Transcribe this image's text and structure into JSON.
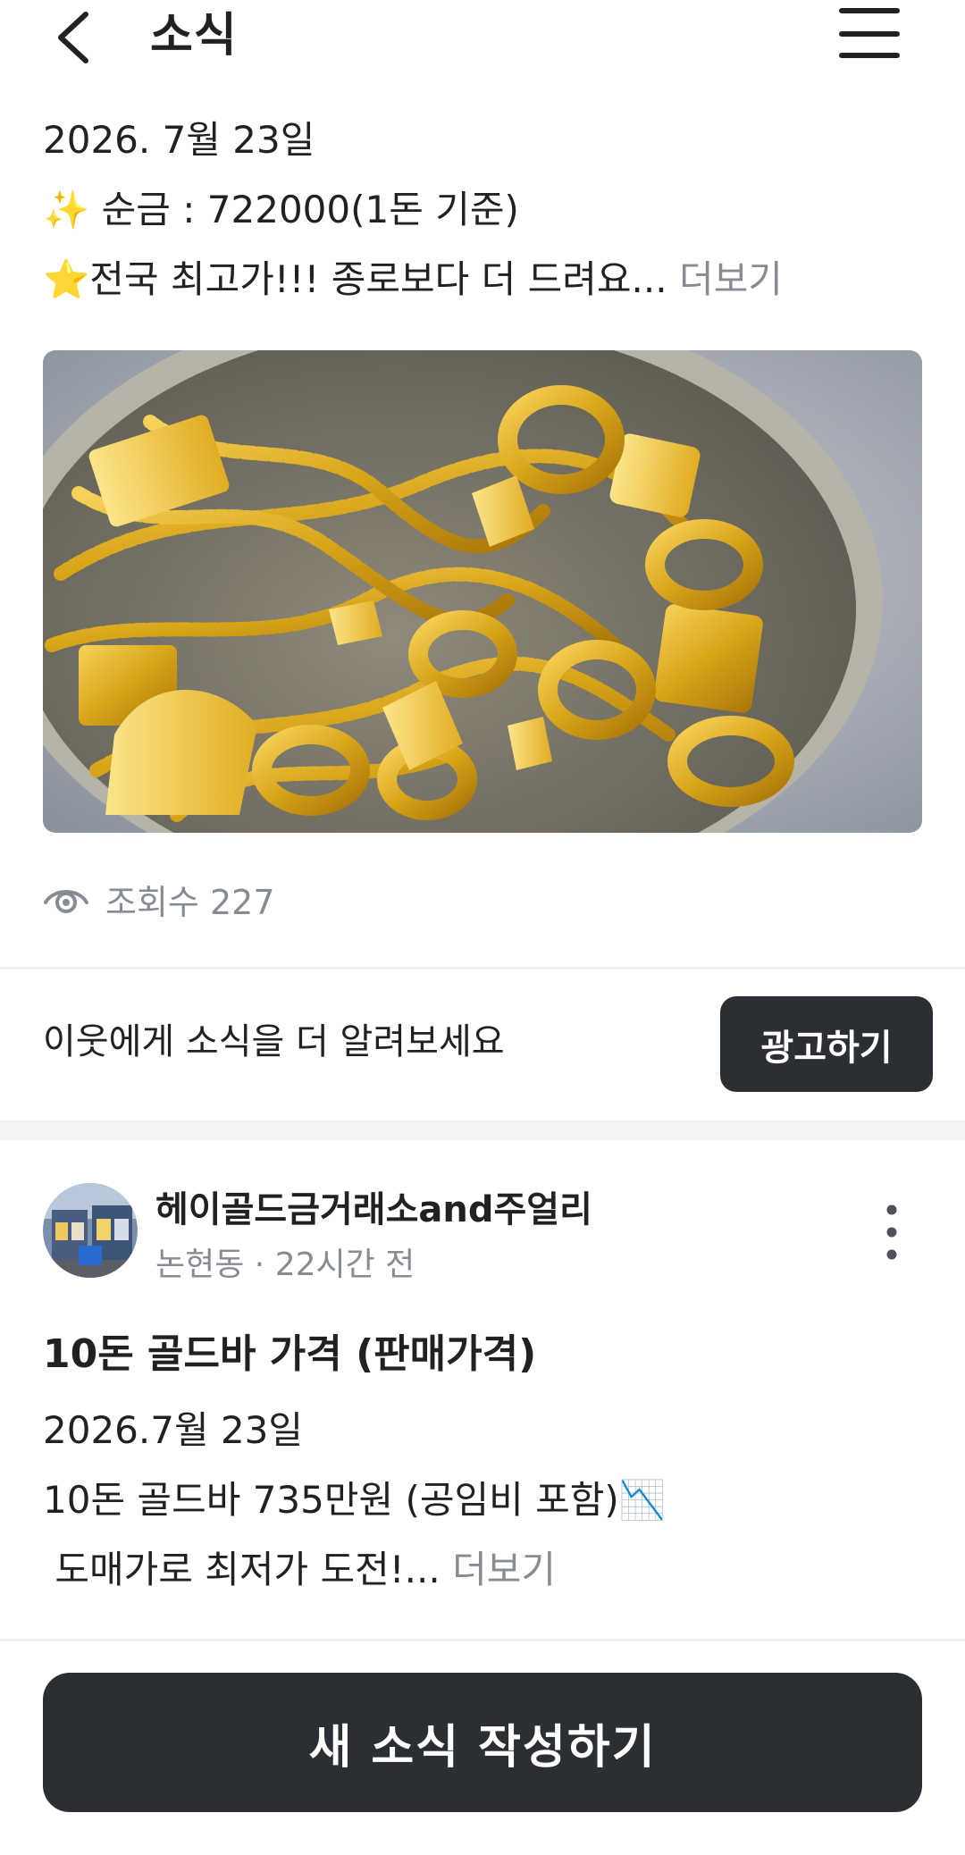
{
  "header": {
    "title": "소식",
    "back_icon": "chevron-left-icon",
    "menu_icon": "hamburger-menu-icon"
  },
  "post1": {
    "date": "2026. 7월 23일",
    "line1_emoji": "✨",
    "line1": " 순금 : 722000(1돈 기준)",
    "line2_emoji": "⭐",
    "line2": "전국 최고가!!! 종로보다 더 드려요...",
    "more": "더보기",
    "views_icon": "eye-icon",
    "views": "조회수 227"
  },
  "promo": {
    "text": "이웃에게 소식을 더 알려보세요",
    "button": "광고하기"
  },
  "post2": {
    "author": "헤이골드금거래소and주얼리",
    "meta": "논현동 · 22시간 전",
    "title": "10돈 골드바 가격 (판매가격)",
    "date": "2026.7월 23일",
    "line1": "10돈 골드바 735만원 (공임비 포함)",
    "line1_emoji": "📉",
    "line2": " 도매가로 최저가 도전!...",
    "more": "더보기"
  },
  "footer": {
    "write_button": "새 소식 작성하기"
  },
  "colors": {
    "text": "#212124",
    "muted": "#868b94",
    "button_dark": "#2b2e33",
    "divider": "#eeeff1",
    "section_gap": "#f2f3f6",
    "gold": "#d9a61c"
  }
}
